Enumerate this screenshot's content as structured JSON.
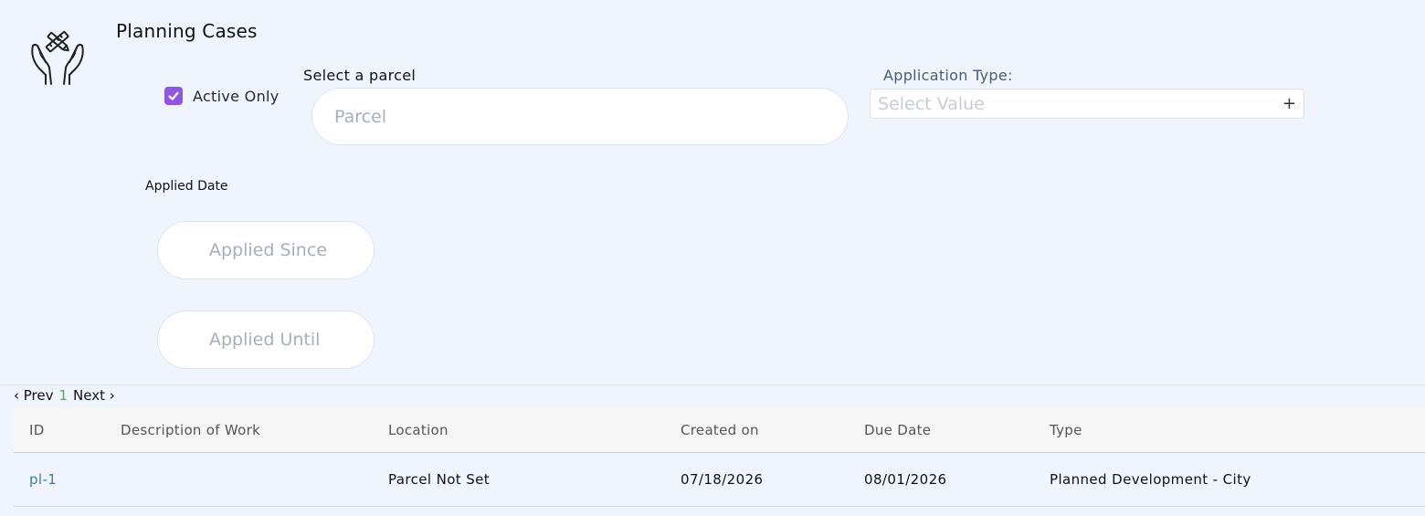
{
  "header": {
    "title": "Planning Cases"
  },
  "filters": {
    "active_only_label": "Active Only",
    "active_only_checked": true,
    "parcel_label": "Select a parcel",
    "parcel_placeholder": "Parcel",
    "application_type_label": "Application Type:",
    "application_type_placeholder": "Select Value",
    "application_type_add": "+",
    "applied_date_label": "Applied Date",
    "applied_since_placeholder": "Applied Since",
    "applied_until_placeholder": "Applied Until"
  },
  "pager": {
    "prev": "‹ Prev",
    "page": "1",
    "next": "Next ›"
  },
  "table": {
    "columns": [
      "ID",
      "Description of Work",
      "Location",
      "Created on",
      "Due Date",
      "Type"
    ],
    "rows": [
      {
        "id": "pl-1",
        "description": "",
        "location": "Parcel Not Set",
        "created_on": "07/18/2026",
        "due_date": "08/01/2026",
        "type": "Planned Development - City"
      }
    ]
  },
  "colors": {
    "accent": "#8f55e4",
    "link": "#3a7fa6",
    "page_bg": "#f0f5fd"
  }
}
